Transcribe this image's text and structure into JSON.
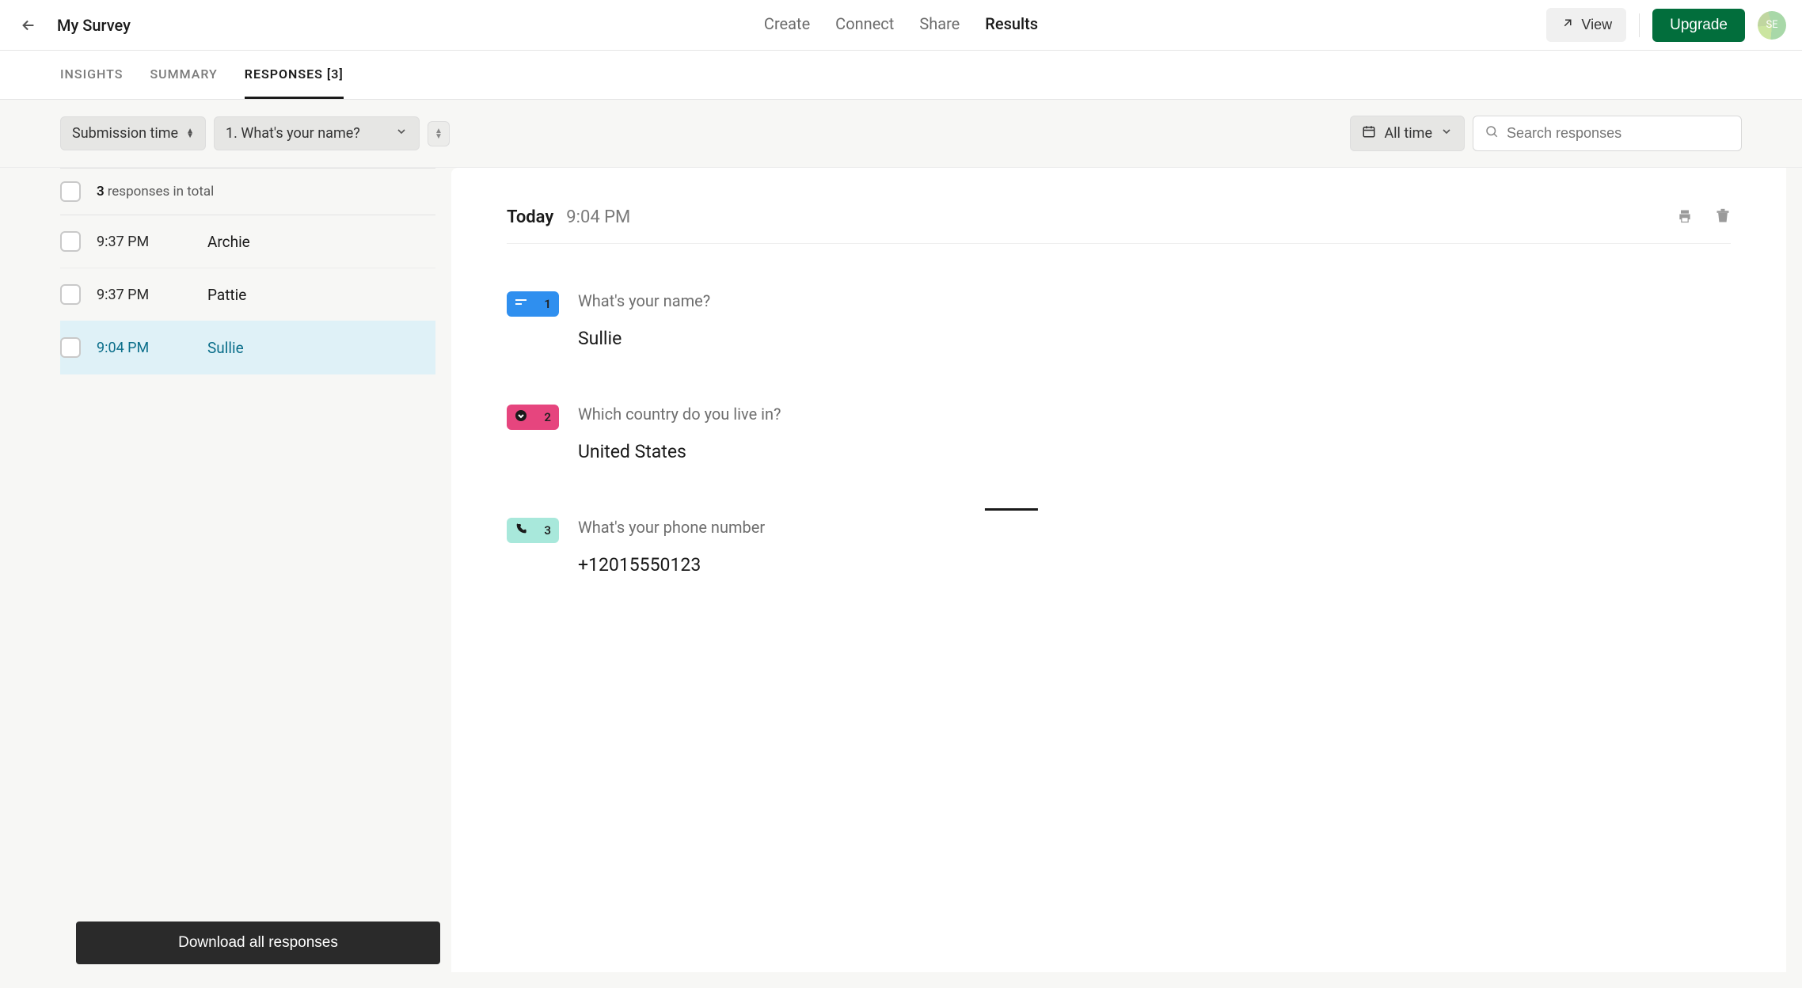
{
  "topbar": {
    "title": "My Survey",
    "tabs": [
      "Create",
      "Connect",
      "Share",
      "Results"
    ],
    "active_tab": "Results",
    "view_label": "View",
    "upgrade_label": "Upgrade",
    "avatar_initials": "SE"
  },
  "subtabs": {
    "items": [
      "INSIGHTS",
      "SUMMARY",
      "RESPONSES [3]"
    ],
    "active": "RESPONSES [3]"
  },
  "toolbar": {
    "sort_label": "Submission time",
    "question_filter": "1. What's your name?",
    "date_filter": "All time",
    "search_placeholder": "Search responses"
  },
  "list": {
    "total_count": "3",
    "total_text": "responses in total",
    "rows": [
      {
        "time": "9:37 PM",
        "name": "Archie",
        "selected": false
      },
      {
        "time": "9:37 PM",
        "name": "Pattie",
        "selected": false
      },
      {
        "time": "9:04 PM",
        "name": "Sullie",
        "selected": true
      }
    ],
    "download_label": "Download all responses"
  },
  "detail": {
    "day": "Today",
    "time": "9:04 PM",
    "questions": [
      {
        "num": "1",
        "badge": "blue",
        "icon_name": "short-text-icon",
        "q": "What's your name?",
        "a": "Sullie"
      },
      {
        "num": "2",
        "badge": "pink",
        "icon_name": "dropdown-icon",
        "q": "Which country do you live in?",
        "a": "United States"
      },
      {
        "num": "3",
        "badge": "teal",
        "icon_name": "phone-icon",
        "q": "What's your phone number",
        "a": "+12015550123"
      }
    ]
  }
}
